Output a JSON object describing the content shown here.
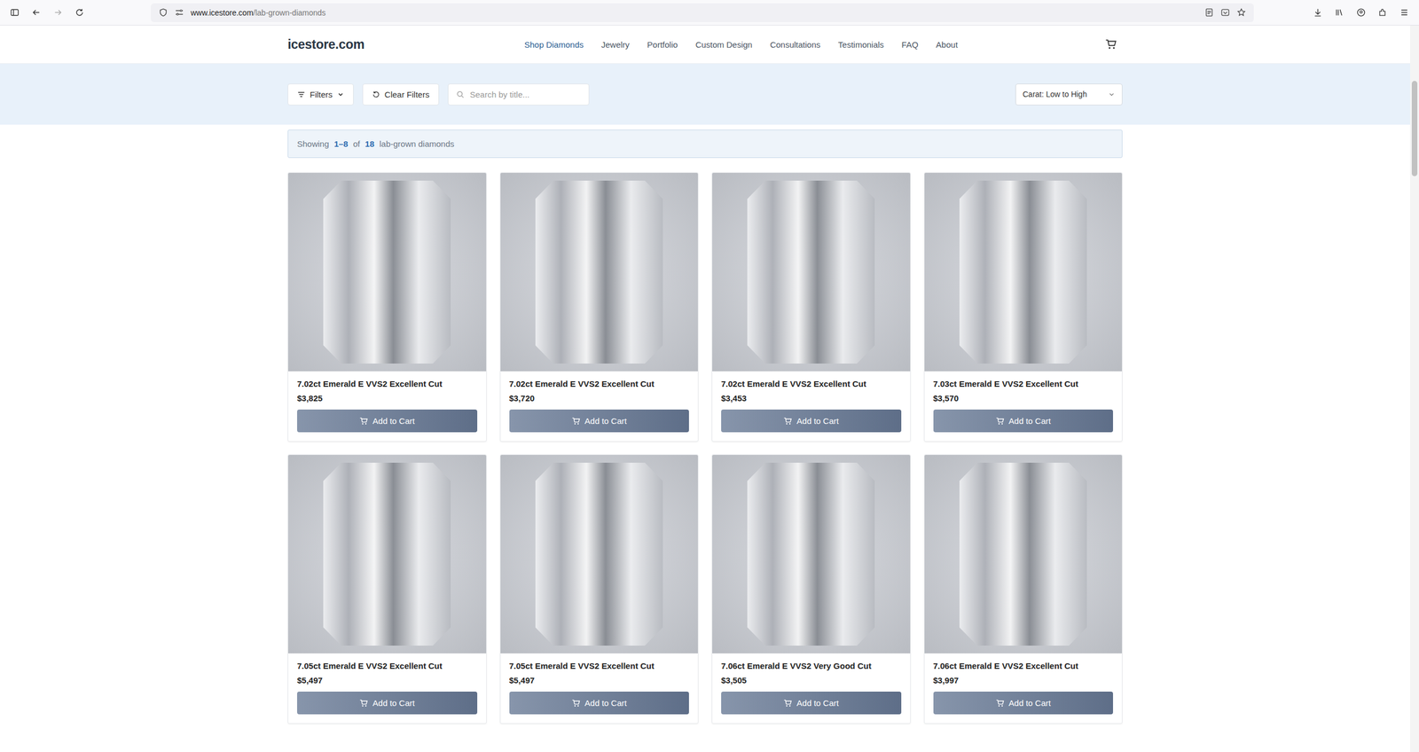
{
  "browser": {
    "url_host": "www.icestore.com",
    "url_path": "/lab-grown-diamonds"
  },
  "site": {
    "logo": "icestore.com",
    "nav": [
      {
        "label": "Shop Diamonds",
        "selected": true
      },
      {
        "label": "Jewelry",
        "selected": false
      },
      {
        "label": "Portfolio",
        "selected": false
      },
      {
        "label": "Custom Design",
        "selected": false
      },
      {
        "label": "Consultations",
        "selected": false
      },
      {
        "label": "Testimonials",
        "selected": false
      },
      {
        "label": "FAQ",
        "selected": false
      },
      {
        "label": "About",
        "selected": false
      }
    ]
  },
  "toolbar": {
    "filters": "Filters",
    "clear": "Clear Filters",
    "search_placeholder": "Search by title...",
    "sort": "Carat: Low to High"
  },
  "summary": {
    "prefix": "Showing",
    "range": "1–8",
    "of": "of",
    "total": "18",
    "suffix": "lab-grown diamonds"
  },
  "products": [
    {
      "title": "7.02ct Emerald E VVS2 Excellent Cut",
      "price": "$3,825",
      "button": "Add to Cart"
    },
    {
      "title": "7.02ct Emerald E VVS2 Excellent Cut",
      "price": "$3,720",
      "button": "Add to Cart"
    },
    {
      "title": "7.02ct Emerald E VVS2 Excellent Cut",
      "price": "$3,453",
      "button": "Add to Cart"
    },
    {
      "title": "7.03ct Emerald E VVS2 Excellent Cut",
      "price": "$3,570",
      "button": "Add to Cart"
    },
    {
      "title": "7.05ct Emerald E VVS2 Excellent Cut",
      "price": "$5,497",
      "button": "Add to Cart"
    },
    {
      "title": "7.05ct Emerald E VVS2 Excellent Cut",
      "price": "$5,497",
      "button": "Add to Cart"
    },
    {
      "title": "7.06ct Emerald E VVS2 Very Good Cut",
      "price": "$3,505",
      "button": "Add to Cart"
    },
    {
      "title": "7.06ct Emerald E VVS2 Excellent Cut",
      "price": "$3,997",
      "button": "Add to Cart"
    }
  ]
}
